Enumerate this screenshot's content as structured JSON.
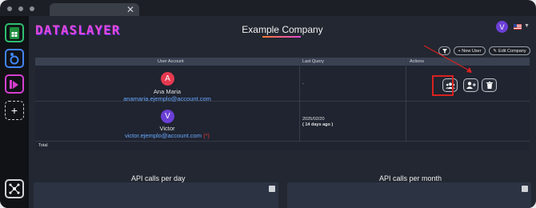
{
  "browser": {
    "tab_close": "✕"
  },
  "sidebar": {
    "items": [
      {
        "name": "sheets",
        "icon": "google-sheets-icon",
        "color": "#1e8e3e"
      },
      {
        "name": "looker",
        "icon": "looker-studio-icon",
        "color": "#4285f4"
      },
      {
        "name": "powerbi",
        "icon": "power-bi-icon",
        "color": "#d43fd0"
      },
      {
        "name": "add",
        "label": "+",
        "icon": "plus-icon"
      }
    ],
    "bottom_icon": "network-hub-icon"
  },
  "header": {
    "logo": "DATASLAYER",
    "company": "Example Company",
    "user_initial": "V",
    "locale_icon": "us-flag-icon"
  },
  "toolbar": {
    "filter_icon": "filter-icon",
    "new_user": "+ New User",
    "edit_company": "Edit Company"
  },
  "table": {
    "headers": [
      "User Account",
      "Last Query",
      "Actions"
    ],
    "rows": [
      {
        "initial": "A",
        "avatar_color": "#e63950",
        "name": "Ana Maria",
        "email": "anamaria.ejemplo@account.com",
        "required": "",
        "last_query": "-",
        "last_query_ago": ""
      },
      {
        "initial": "V",
        "avatar_color": "#6b3fd6",
        "name": "Victor",
        "email": "victor.ejemplo@account.com",
        "required": "(*)",
        "last_query": "2025/02/20",
        "last_query_ago": "( 14 days ago )"
      }
    ],
    "total_label": "Total"
  },
  "actions": [
    {
      "name": "manage-users",
      "icon": "users-group-icon"
    },
    {
      "name": "assign-user",
      "icon": "user-plus-icon"
    },
    {
      "name": "delete",
      "icon": "trash-icon"
    }
  ],
  "charts": [
    {
      "title": "API calls per day"
    },
    {
      "title": "API calls per month"
    }
  ]
}
